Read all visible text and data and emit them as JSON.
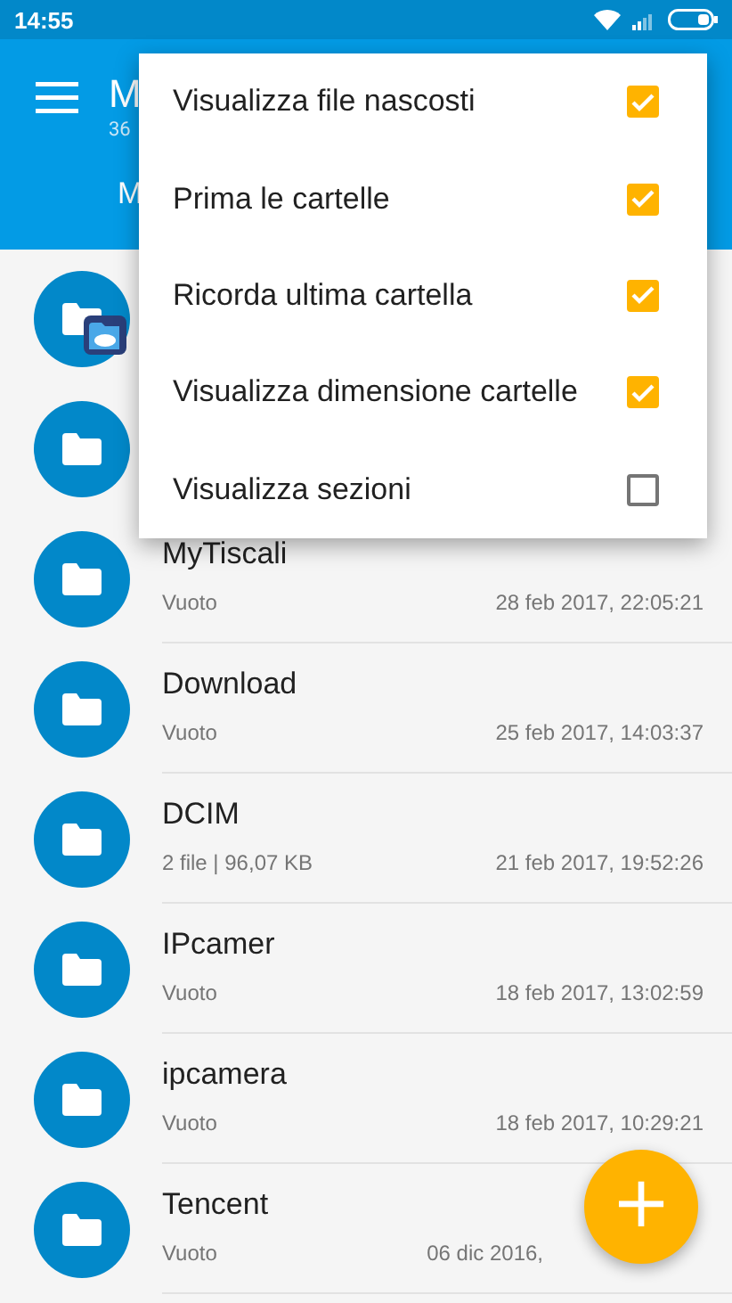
{
  "status_bar": {
    "time": "14:55"
  },
  "app_bar": {
    "title": "M",
    "subtitle": "36",
    "tab": "M"
  },
  "menu": [
    {
      "label": "Visualizza file nascosti",
      "checked": true
    },
    {
      "label": "Prima le cartelle",
      "checked": true
    },
    {
      "label": "Ricorda ultima cartella",
      "checked": true
    },
    {
      "label": "Visualizza dimensione cartelle",
      "checked": true
    },
    {
      "label": "Visualizza sezioni",
      "checked": false
    }
  ],
  "rows": [
    {
      "kind": "covered",
      "badge": true
    },
    {
      "kind": "covered",
      "badge": false
    },
    {
      "kind": "folder",
      "name": "MyTiscali",
      "info": "Vuoto",
      "date": "28 feb 2017, 22:05:21"
    },
    {
      "kind": "folder",
      "name": "Download",
      "info": "Vuoto",
      "date": "25 feb 2017, 14:03:37"
    },
    {
      "kind": "folder",
      "name": "DCIM",
      "info": "2 file  |  96,07 KB",
      "date": "21 feb 2017, 19:52:26"
    },
    {
      "kind": "folder",
      "name": "IPcamer",
      "info": "Vuoto",
      "date": "18 feb 2017, 13:02:59"
    },
    {
      "kind": "folder",
      "name": "ipcamera",
      "info": "Vuoto",
      "date": "18 feb 2017, 10:29:21"
    },
    {
      "kind": "folder",
      "name": "Tencent",
      "info": "Vuoto",
      "date": "06 dic 2016,"
    }
  ],
  "fab": {
    "label": "+"
  }
}
